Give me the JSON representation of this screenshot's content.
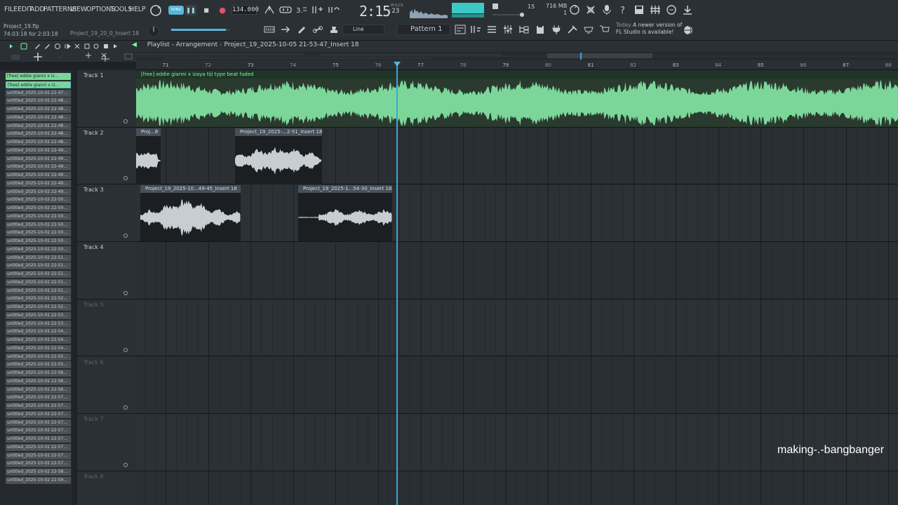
{
  "menu": [
    "FILE",
    "EDIT",
    "ADD",
    "PATTERNS",
    "VIEW",
    "OPTIONS",
    "TOOLS",
    "HELP"
  ],
  "transport": {
    "song_label": "SONG",
    "tempo": "134.000",
    "clock_main": "2:15",
    "clock_sub": ":23",
    "clock_units": "M:S:CS",
    "cpu_count": "15",
    "memory": "716 MB",
    "polyphony": "1"
  },
  "project": {
    "file": "Project_19.flp",
    "time_info": "74:03:18 for 2:03:18",
    "hint": "Project_19_20_0_Insert 18"
  },
  "toolbar2": {
    "snap": "Line",
    "pattern": "Pattern 1"
  },
  "news": {
    "day": "Today",
    "line1": "A newer version of",
    "line2": "FL Studio is available!"
  },
  "playlist": {
    "title": "Playlist - Arrangement",
    "separator": "›",
    "current": "Project_19_2025-10-05 21-53-47_Insert 18"
  },
  "ruler": {
    "bars": [
      "71",
      "72",
      "73",
      "74",
      "75",
      "76",
      "77",
      "78",
      "79",
      "80",
      "81",
      "82",
      "83",
      "84",
      "85",
      "86",
      "87",
      "88"
    ]
  },
  "browser": {
    "entries": [
      "[free] eddie gianni x iz...",
      "[free] eddie gianni x iz...",
      "untitled_2025-10-02 22-47...",
      "untitled_2025-10-02 22-48...",
      "untitled_2025-10-02 22-48...",
      "untitled_2025-10-02 22-48...",
      "untitled_2025-10-02 22-48...",
      "untitled_2025-10-02 22-48...",
      "untitled_2025-10-02 22-48...",
      "untitled_2025-10-02 22-49...",
      "untitled_2025-10-02 22-49...",
      "untitled_2025-10-02 22-49...",
      "untitled_2025-10-02 22-49...",
      "untitled_2025-10-02 22-49...",
      "untitled_2025-10-02 22-49...",
      "untitled_2025-10-02 22-50...",
      "untitled_2025-10-02 22-50...",
      "untitled_2025-10-02 22-50...",
      "untitled_2025-10-02 22-50...",
      "untitled_2025-10-02 22-50...",
      "untitled_2025-10-02 22-50...",
      "untitled_2025-10-02 22-50...",
      "untitled_2025-10-02 22-51...",
      "untitled_2025-10-02 22-51...",
      "untitled_2025-10-02 22-51...",
      "untitled_2025-10-02 22-51...",
      "untitled_2025-10-02 22-51...",
      "untitled_2025-10-02 22-52...",
      "untitled_2025-10-02 22-52...",
      "untitled_2025-10-02 22-53...",
      "untitled_2025-10-02 22-53...",
      "untitled_2025-10-02 22-54...",
      "untitled_2025-10-02 22-54...",
      "untitled_2025-10-02 22-54...",
      "untitled_2025-10-02 22-55...",
      "untitled_2025-10-02 22-55...",
      "untitled_2025-10-02 22-56...",
      "untitled_2025-10-02 22-56...",
      "untitled_2025-10-02 22-56...",
      "untitled_2025-10-02 22-57...",
      "untitled_2025-10-02 22-57...",
      "untitled_2025-10-02 22-57...",
      "untitled_2025-10-02 22-57...",
      "untitled_2025-10-02 22-57...",
      "untitled_2025-10-02 22-57...",
      "untitled_2025-10-02 22-57...",
      "untitled_2025-10-02 22-57...",
      "untitled_2025-10-02 22-57...",
      "untitled_2025-10-02 22-58...",
      "untitled_2025-10-02 22-59..."
    ]
  },
  "tracks": [
    {
      "name": "Track 1",
      "active": true
    },
    {
      "name": "Track 2",
      "active": true
    },
    {
      "name": "Track 3",
      "active": true
    },
    {
      "name": "Track 4",
      "active": true
    },
    {
      "name": "Track 5",
      "active": false
    },
    {
      "name": "Track 6",
      "active": false
    },
    {
      "name": "Track 7",
      "active": false
    },
    {
      "name": "Track 8",
      "active": false
    }
  ],
  "clips": {
    "track1": "[free] eddie gianni x izaya tiji type beat faded",
    "track2_a": "Proj...8",
    "track2_b": "Project_19_2025-...2-51_Insert 18",
    "track3_a": "Project_19_2025-10...49-45_Insert 18",
    "track3_b": "Project_19_2025-1...54-30_Insert 18"
  },
  "colors": {
    "accent": "#57b6d8",
    "audio_green": "#7cd69a",
    "clip_title_green": "#7cf7a3",
    "waveform_grey": "#c8cdd1",
    "playhead": "#3aa6d8"
  },
  "watermark": "making-.-bangbanger"
}
